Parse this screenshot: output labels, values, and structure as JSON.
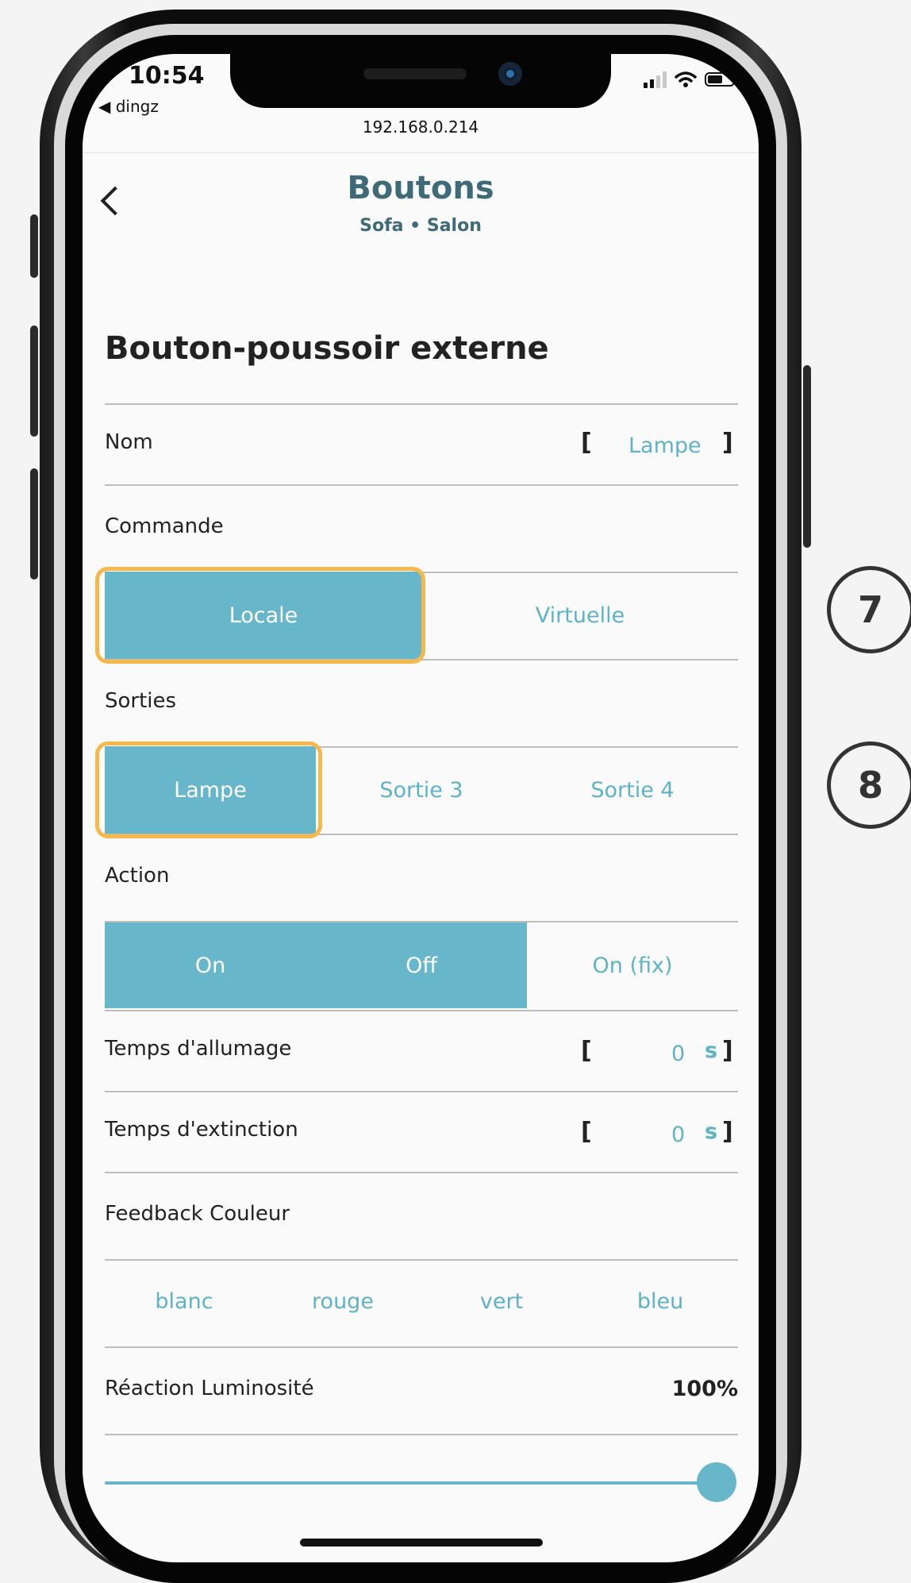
{
  "status_bar": {
    "time": "10:54",
    "back_app": "◀ dingz"
  },
  "browser": {
    "url": "192.168.0.214"
  },
  "header": {
    "title": "Boutons",
    "subtitle": "Sofa • Salon"
  },
  "section_title": "Bouton-poussoir externe",
  "nom": {
    "label": "Nom",
    "bracket_open": "[",
    "value": "Lampe",
    "bracket_close": "]"
  },
  "commande": {
    "label": "Commande",
    "options": [
      "Locale",
      "Virtuelle"
    ],
    "selected": "Locale"
  },
  "sorties": {
    "label": "Sorties",
    "options": [
      "Lampe",
      "Sortie 3",
      "Sortie 4"
    ],
    "selected": "Lampe"
  },
  "action": {
    "label": "Action",
    "options": [
      "On",
      "Off",
      "On (fix)"
    ]
  },
  "temps_allumage": {
    "label": "Temps d'allumage",
    "bracket_open": "[",
    "value": "0",
    "unit": "s",
    "bracket_close": "]"
  },
  "temps_extinction": {
    "label": "Temps d'extinction",
    "bracket_open": "[",
    "value": "0",
    "unit": "s",
    "bracket_close": "]"
  },
  "feedback": {
    "label": "Feedback Couleur",
    "options": [
      "blanc",
      "rouge",
      "vert",
      "bleu"
    ]
  },
  "luminosite": {
    "label": "Réaction Luminosité",
    "value": "100%",
    "level": 1.0
  },
  "callouts": [
    "7",
    "8"
  ],
  "colors": {
    "accent": "#67b6c9",
    "accent_text": "#5fb3c6",
    "title": "#3f6b78",
    "highlight": "#f7b84b"
  }
}
